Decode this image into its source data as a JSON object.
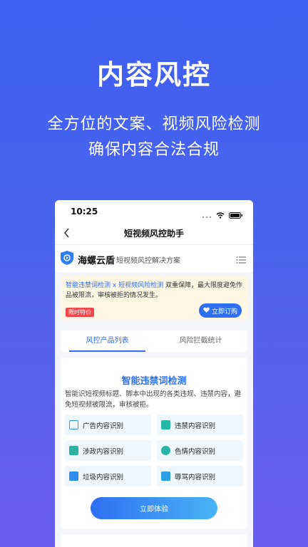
{
  "promo": {
    "title": "内容风控",
    "subtitle_line1": "全方位的文案、视频风险检测",
    "subtitle_line2": "确保内容合法合规"
  },
  "statusbar": {
    "time": "10:25"
  },
  "navbar": {
    "title": "短视频风控助手"
  },
  "brand": {
    "name": "海螺云盾",
    "tagline": "短视频风控解决方案"
  },
  "notice": {
    "highlight1": "智能违禁词检测",
    "connector": " x ",
    "highlight2": "短视频风险检测",
    "text": " 双重保障，最大限度避免作品被限流，审核被拒的情况发生。",
    "badge": "限时特价",
    "subscribe": "立即订购"
  },
  "tabs": [
    {
      "label": "风控产品列表"
    },
    {
      "label": "风险拦截统计"
    }
  ],
  "card": {
    "title": "智能违禁词检测",
    "description": "智能识短视频标题、脚本中出现的各类违规、违禁内容，避免短视频被限流，审核被拒。",
    "features": [
      {
        "label": "广告内容识别",
        "icon": "ad-icon",
        "color": "#2f9bf0"
      },
      {
        "label": "违禁内容识别",
        "icon": "forbidden-doc-icon",
        "color": "#26b7a8"
      },
      {
        "label": "涉政内容识别",
        "icon": "politics-icon",
        "color": "#2bb2a0"
      },
      {
        "label": "色情内容识别",
        "icon": "adult-icon",
        "color": "#25b4a6"
      },
      {
        "label": "垃圾内容识别",
        "icon": "spam-icon",
        "color": "#2d8ef0"
      },
      {
        "label": "辱骂内容识别",
        "icon": "abuse-icon",
        "color": "#2a9fe8"
      }
    ],
    "try_button": "立即体验"
  }
}
